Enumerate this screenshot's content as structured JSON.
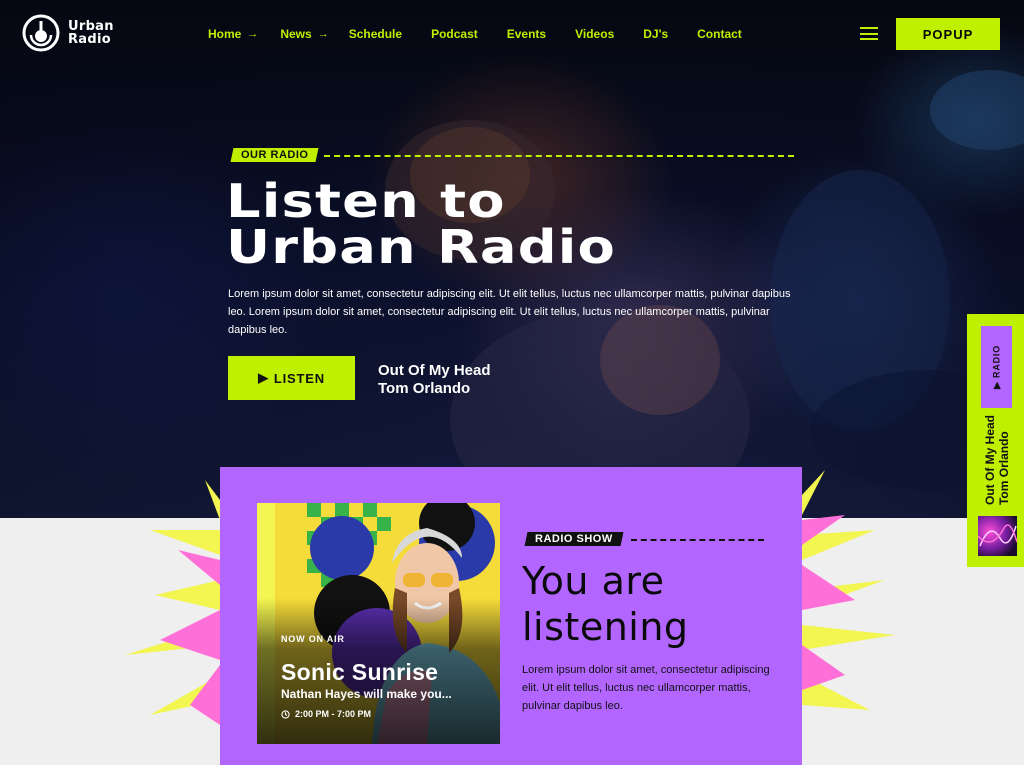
{
  "brand": {
    "line1": "Urban",
    "line2": "Radio"
  },
  "nav": [
    {
      "label": "Home",
      "arrow": true
    },
    {
      "label": "News",
      "arrow": true
    },
    {
      "label": "Schedule",
      "arrow": false
    },
    {
      "label": "Podcast",
      "arrow": false
    },
    {
      "label": "Events",
      "arrow": false
    },
    {
      "label": "Videos",
      "arrow": false
    },
    {
      "label": "DJ's",
      "arrow": false
    },
    {
      "label": "Contact",
      "arrow": false
    }
  ],
  "header": {
    "popup_label": "POPUP",
    "menu_icon": "hamburger-icon"
  },
  "hero": {
    "tag": "OUR RADIO",
    "title_line1": "Listen to",
    "title_line2": "Urban Radio",
    "description": "Lorem ipsum dolor sit amet, consectetur adipiscing elit. Ut elit tellus, luctus nec ullamcorper mattis, pulvinar dapibus leo. Lorem ipsum dolor sit amet, consectetur adipiscing elit. Ut elit tellus, luctus nec ullamcorper mattis, pulvinar dapibus leo.",
    "listen_label": "LISTEN",
    "track_title": "Out Of My Head",
    "track_artist": "Tom Orlando"
  },
  "show": {
    "badge": "NOW ON AIR",
    "name": "Sonic Sunrise",
    "subtitle": "Nathan Hayes will make you...",
    "time": "2:00 PM - 7:00 PM"
  },
  "radio_show": {
    "tag": "RADIO SHOW",
    "title_line1": "You are",
    "title_line2": "listening",
    "description": "Lorem ipsum dolor sit amet, consectetur adipiscing elit. Ut elit tellus, luctus nec ullamcorper mattis, pulvinar dapibus leo."
  },
  "side_player": {
    "tab_label": "RADIO",
    "track_title": "Out Of My Head",
    "track_artist": "Tom Orlando"
  },
  "colors": {
    "accent": "#bff000",
    "purple": "#b266ff",
    "pink": "#ff6fd8",
    "yellow": "#f3f550"
  }
}
